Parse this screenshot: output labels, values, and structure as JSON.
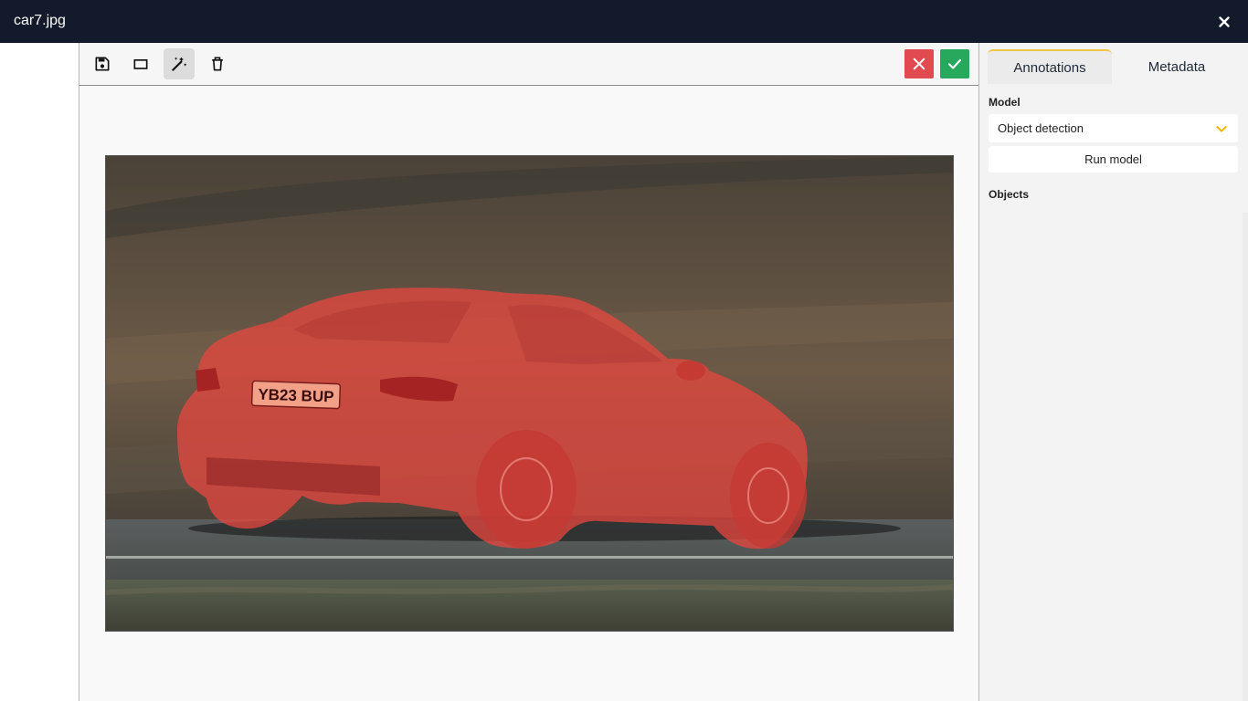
{
  "window": {
    "title": "car7.jpg",
    "close_icon": "close-icon"
  },
  "toolbar": {
    "tools": [
      {
        "name": "save",
        "icon": "save-icon",
        "active": false
      },
      {
        "name": "rectangle",
        "icon": "rectangle-icon",
        "active": false
      },
      {
        "name": "magic-wand",
        "icon": "magic-wand-icon",
        "active": true
      },
      {
        "name": "delete",
        "icon": "trash-icon",
        "active": false
      }
    ],
    "reject_icon": "close-icon",
    "accept_icon": "check-icon",
    "colors": {
      "reject": "#e04a50",
      "accept": "#26a85d"
    }
  },
  "image": {
    "plate_text": "YB23 BUP",
    "mask_color": "#e8473f"
  },
  "panel": {
    "tabs": [
      {
        "label": "Annotations",
        "active": true
      },
      {
        "label": "Metadata",
        "active": false
      }
    ],
    "model_label": "Model",
    "model_value": "Object detection",
    "run_label": "Run model",
    "objects_label": "Objects",
    "accent": "#f4c542"
  }
}
